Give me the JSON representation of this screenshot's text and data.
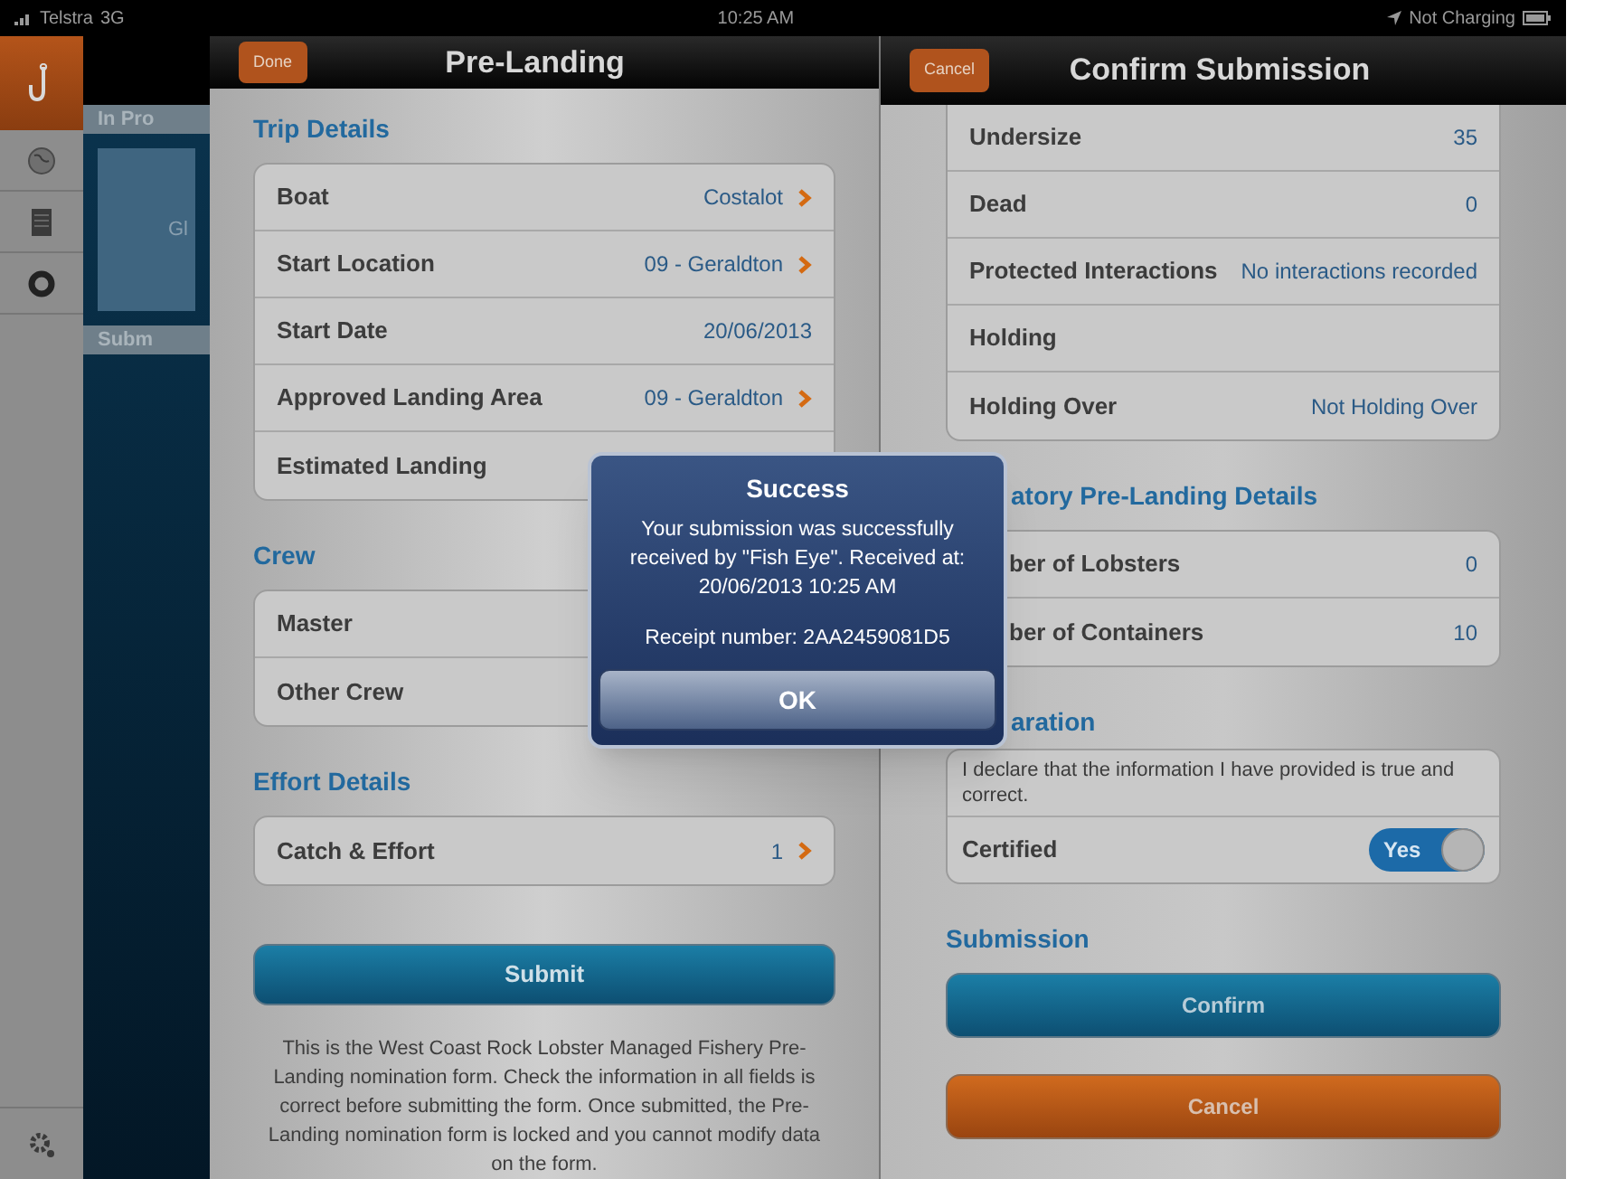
{
  "status_bar": {
    "carrier": "Telstra",
    "network": "3G",
    "time": "10:25 AM",
    "charging": "Not Charging"
  },
  "sidebar": {
    "sections": [
      {
        "label": "In Pro"
      },
      {
        "label": "Subm"
      }
    ],
    "tile": "Gl"
  },
  "left_panel": {
    "title": "Pre-Landing",
    "done_button": "Done",
    "sections": [
      {
        "heading": "Trip Details",
        "rows": [
          {
            "label": "Boat",
            "value": "Costalot",
            "disclosure": true
          },
          {
            "label": "Start Location",
            "value": "09 - Geraldton",
            "disclosure": true
          },
          {
            "label": "Start Date",
            "value": "20/06/2013",
            "disclosure": false
          },
          {
            "label": "Approved Landing Area",
            "value": "09 - Geraldton",
            "disclosure": true
          },
          {
            "label": "Estimated Landing",
            "disclosure": false
          }
        ]
      },
      {
        "heading": "Crew",
        "rows": [
          {
            "label": "Master",
            "disclosure": false
          },
          {
            "label": "Other Crew",
            "disclosure": false
          }
        ]
      },
      {
        "heading": "Effort Details",
        "rows": [
          {
            "label": "Catch & Effort",
            "value": "1",
            "disclosure": true
          }
        ]
      }
    ],
    "submit_button": "Submit",
    "note": "This is the West Coast Rock Lobster Managed Fishery Pre-Landing nomination form. Check the information in all fields is correct before submitting the form. Once submitted, the Pre-Landing nomination form is locked and you cannot modify data on the form."
  },
  "right_panel": {
    "title": "Confirm Submission",
    "cancel_button": "Cancel",
    "top_rows": [
      {
        "label": "Undersize",
        "value": "35"
      },
      {
        "label": "Dead",
        "value": "0"
      },
      {
        "label": "Protected Interactions",
        "value": "No interactions recorded"
      },
      {
        "label": "Holding"
      },
      {
        "label": "Holding Over",
        "value": "Not Holding Over"
      }
    ],
    "mandatory": {
      "heading": "atory Pre-Landing Details",
      "rows": [
        {
          "label": "ber of Lobsters",
          "value": "0"
        },
        {
          "label": "ber of Containers",
          "value": "10"
        }
      ]
    },
    "declaration": {
      "heading": "aration",
      "text": "I declare that the information I have provided is true and correct.",
      "label": "Certified",
      "switch_text": "Yes",
      "on": true
    },
    "submission": {
      "heading": "Submission",
      "confirm_button": "Confirm",
      "cancel_button": "Cancel"
    }
  },
  "alert": {
    "title": "Success",
    "message": "Your submission was successfully received by \"Fish Eye\". Received at: 20/06/2013 10:25 AM",
    "receipt": "Receipt number: 2AA2459081D5",
    "button": "OK"
  }
}
